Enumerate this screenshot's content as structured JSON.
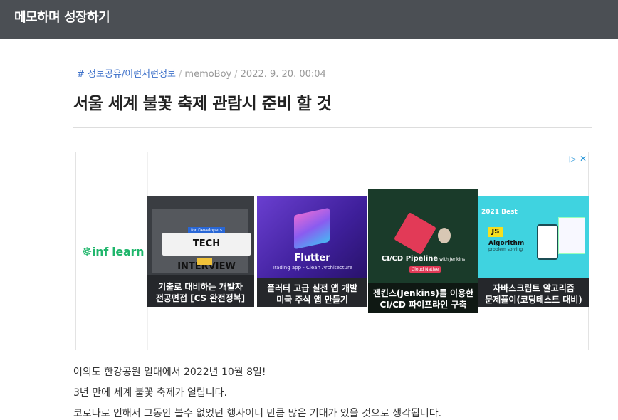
{
  "header": {
    "site_title": "메모하며 성장하기"
  },
  "post": {
    "category": "# 정보공유/이런저런정보",
    "author": "memoBoy",
    "date": "2022. 9. 20. 00:04",
    "separator": "/",
    "title": "서울 세계 불꽃 축제 관람시 준비 할 것",
    "body": [
      "여의도 한강공원 일대에서 2022년 10월 8일!",
      "3년 만에 세계 불꽃 축제가 열립니다.",
      "코로나로 인해서 그동안 볼수 없었던 행사이니 만큼 많은 기대가 있을 것으로 생각됩니다."
    ]
  },
  "ad": {
    "brand": "inflearn",
    "logo_text": "☸inf learn",
    "adchoices_icons": [
      "adchoices-play-icon",
      "ad-close-icon"
    ],
    "cards": [
      {
        "thumb_title": "TECH INTERVIEW",
        "thumb_tag": "for Developers",
        "caption": [
          "기출로 대비하는 개발자",
          "전공면접 [CS 완전정복]"
        ]
      },
      {
        "thumb_title": "Flutter",
        "thumb_subtitle": "Trading app - Clean Architecture",
        "caption": [
          "플러터 고급 실전 앱 개발",
          "미국 주식 앱 만들기"
        ]
      },
      {
        "thumb_title": "CI/CD Pipeline",
        "thumb_title_suffix": "with Jenkins",
        "thumb_badge": "Cloud Native",
        "caption": [
          "젠킨스(Jenkins)를 이용한",
          "CI/CD 파이프라인 구축"
        ]
      },
      {
        "thumb_year": "2021 Best",
        "thumb_js": "JS",
        "thumb_title": "Algorithm",
        "thumb_subtitle": "problem solving",
        "caption": [
          "자바스크립트 알고리즘",
          "문제풀이(코딩테스트 대비)"
        ]
      }
    ]
  },
  "colors": {
    "topbar": "#4b4f54",
    "category_link": "#3b6fc9",
    "inflearn_green": "#1fb66b"
  }
}
